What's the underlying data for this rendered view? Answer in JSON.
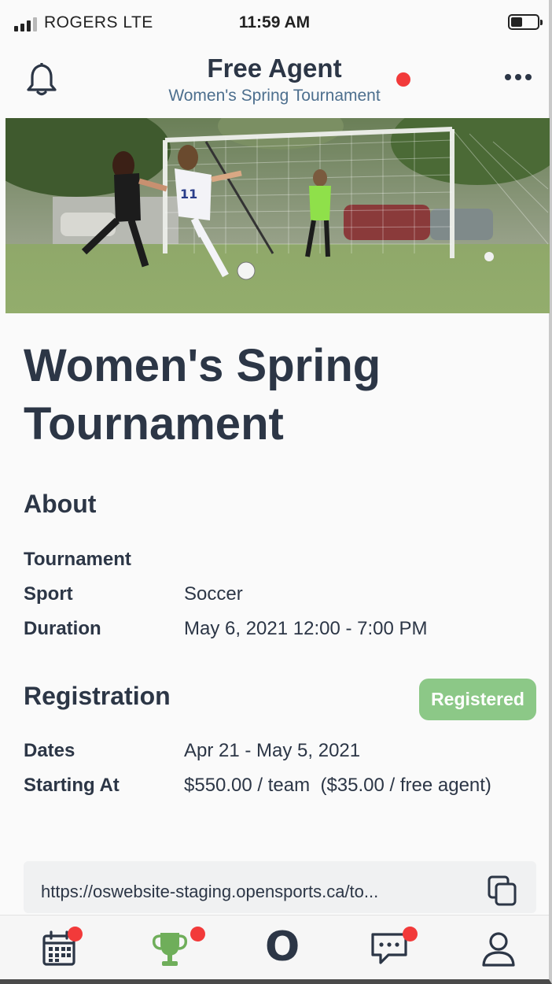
{
  "status": {
    "carrier": "ROGERS LTE",
    "time": "11:59 AM"
  },
  "header": {
    "title": "Free Agent",
    "subtitle": "Women's Spring Tournament"
  },
  "event": {
    "title": "Women's Spring Tournament"
  },
  "about": {
    "heading": "About",
    "rows": [
      {
        "label": "Tournament",
        "value": ""
      },
      {
        "label": "Sport",
        "value": "Soccer"
      },
      {
        "label": "Duration",
        "value": "May 6, 2021 12:00 - 7:00 PM"
      }
    ]
  },
  "registration": {
    "heading": "Registration",
    "badge": "Registered",
    "rows": [
      {
        "label": "Dates",
        "value": "Apr 21 - May 5, 2021"
      },
      {
        "label": "Starting At",
        "value": "$550.00 / team  ($35.00 / free agent)"
      }
    ]
  },
  "share": {
    "url": "https://oswebsite-staging.opensports.ca/to..."
  },
  "tabbar": {
    "items": [
      "calendar-icon",
      "trophy-icon",
      "opensports-logo",
      "chat-icon",
      "profile-icon"
    ],
    "logo_text": "O"
  },
  "colors": {
    "accent_red": "#f23a3a",
    "registered_green": "#8cc887",
    "trophy_green": "#6fae5a",
    "text_dark": "#2c3646"
  }
}
